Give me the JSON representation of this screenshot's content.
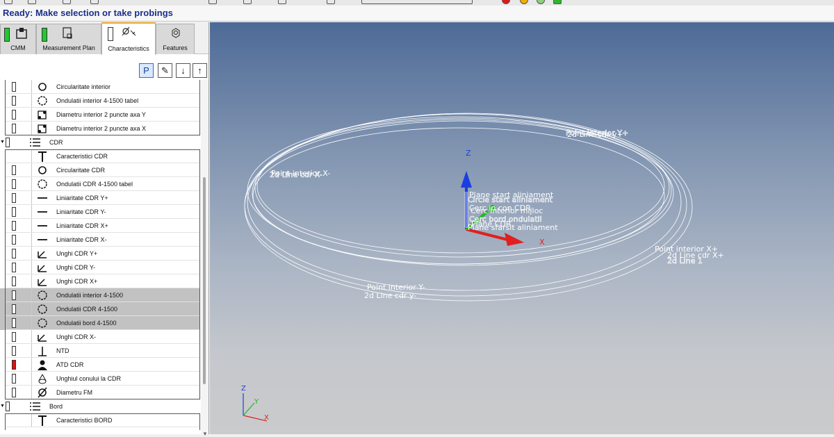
{
  "status_text": "Ready: Make selection or take probings",
  "tabs": [
    {
      "label": "CMM",
      "icon": "cmm-icon"
    },
    {
      "label": "Measurement Plan",
      "icon": "measurement-plan-icon"
    },
    {
      "label": "Characteristics",
      "icon": "characteristics-icon",
      "active": true
    },
    {
      "label": "Features",
      "icon": "features-icon"
    }
  ],
  "panel_buttons": [
    {
      "label": "P",
      "icon": "program-icon"
    },
    {
      "label": "✎",
      "icon": "pencil-icon"
    },
    {
      "label": "↓",
      "icon": "arrow-down-icon"
    },
    {
      "label": "↑",
      "icon": "arrow-up-icon"
    }
  ],
  "tree_top_items": [
    {
      "label": "Circularitate  interior",
      "icon": "circularity-icon"
    },
    {
      "label": "Ondulatii  interior 4-1500 tabel",
      "icon": "roundness-icon"
    },
    {
      "label": "Diametru interior 2 puncte axa Y",
      "icon": "two-point-diameter-icon"
    },
    {
      "label": "Diametru interior 2 puncte axa X",
      "icon": "two-point-diameter-icon"
    }
  ],
  "group_cdr": {
    "label": "CDR",
    "icon": "group-list-icon"
  },
  "cdr_items": [
    {
      "label": "Caracteristici CDR",
      "icon": "text-icon",
      "status": "none"
    },
    {
      "label": "Circularitate CDR",
      "icon": "circularity-icon",
      "status": "white"
    },
    {
      "label": "Ondulatii CDR  4-1500 tabel",
      "icon": "roundness-icon",
      "status": "white"
    },
    {
      "label": "Liniaritate CDR Y+",
      "icon": "straightness-icon",
      "status": "white"
    },
    {
      "label": "Liniaritate CDR Y-",
      "icon": "straightness-icon",
      "status": "white"
    },
    {
      "label": "Liniaritate CDR X+",
      "icon": "straightness-icon",
      "status": "white"
    },
    {
      "label": "Liniaritate CDR X-",
      "icon": "straightness-icon",
      "status": "white"
    },
    {
      "label": "Unghi CDR Y+",
      "icon": "angle-icon",
      "status": "white"
    },
    {
      "label": "Unghi CDR Y-",
      "icon": "angle-icon",
      "status": "white"
    },
    {
      "label": "Unghi CDR X+",
      "icon": "angle-icon",
      "status": "white"
    },
    {
      "label": "Ondulatii interior 4-1500",
      "icon": "roundness-icon",
      "status": "white",
      "highlight": true
    },
    {
      "label": "Ondulatii CDR  4-1500",
      "icon": "roundness-icon",
      "status": "white",
      "highlight": true
    },
    {
      "label": "Ondulatii bord 4-1500",
      "icon": "roundness-icon",
      "status": "white",
      "highlight": true
    },
    {
      "label": "Unghi CDR X-",
      "icon": "angle-icon",
      "status": "white"
    },
    {
      "label": "NTD",
      "icon": "perpendicularity-icon",
      "status": "white"
    },
    {
      "label": "ATD CDR",
      "icon": "person-icon",
      "status": "red"
    },
    {
      "label": "Unghiul conului la CDR",
      "icon": "cone-angle-icon",
      "status": "white"
    },
    {
      "label": "Diametru FM",
      "icon": "diameter-icon",
      "status": "white"
    }
  ],
  "group_bord": {
    "label": "Bord",
    "icon": "group-list-icon"
  },
  "bord_items": [
    {
      "label": "Caracteristici BORD",
      "icon": "text-icon",
      "status": "none"
    }
  ],
  "viewport": {
    "axis_labels": {
      "z": "Z",
      "x": "X"
    },
    "mini_axis_labels": {
      "z": "Z",
      "y": "Y",
      "x": "X"
    },
    "feature_labels": [
      {
        "text": "Point interior X-"
      },
      {
        "text": "2d Line cdr X-"
      },
      {
        "text": "2d Line cdr y+"
      },
      {
        "text": "Point interior Y+"
      },
      {
        "text": "Point interior X+"
      },
      {
        "text": "2d Line cdr X+"
      },
      {
        "text": "2d Line 1"
      },
      {
        "text": "Point interior Y-"
      },
      {
        "text": "2d Line cdr y-"
      },
      {
        "text": "Plane start aliniament"
      },
      {
        "text": "Circle start aliniament"
      },
      {
        "text": "Cerc interior mijloc"
      },
      {
        "text": "Cerc in con CDR"
      },
      {
        "text": "Cerc bord ondulatii"
      },
      {
        "text": "Plane CDR"
      },
      {
        "text": "Plane sfarsit aliniament"
      }
    ],
    "colors": {
      "x_axis": "#e02020",
      "y_axis": "#22b822",
      "z_axis": "#1c3ee0"
    }
  }
}
